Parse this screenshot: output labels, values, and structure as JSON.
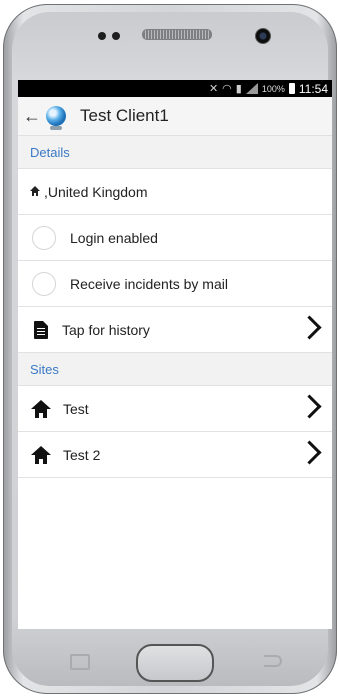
{
  "status_bar": {
    "battery": "100%",
    "time": "11:54"
  },
  "app_bar": {
    "title": "Test Client1"
  },
  "details": {
    "header": "Details",
    "address": ",United Kingdom",
    "login_label": "Login enabled",
    "mail_label": "Receive incidents by mail",
    "history_label": "Tap for history"
  },
  "sites": {
    "header": "Sites",
    "items": [
      {
        "label": "Test"
      },
      {
        "label": "Test 2"
      }
    ]
  },
  "colors": {
    "section_text": "#3b79c4",
    "section_bg": "#f2f2f2"
  }
}
